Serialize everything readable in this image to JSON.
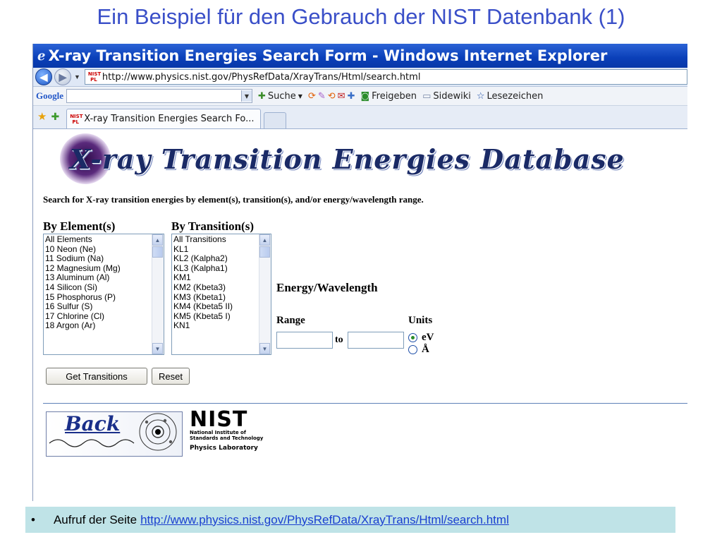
{
  "slide": {
    "title": "Ein Beispiel für den Gebrauch der NIST Datenbank (1)",
    "caption_prefix": "Aufruf der Seite",
    "caption_link": "http://www.physics.nist.gov/PhysRefData/XrayTrans/Html/search.html",
    "bullet": "•"
  },
  "browser": {
    "title": "X-ray Transition Energies Search Form - Windows Internet Explorer",
    "address": "http://www.physics.nist.gov/PhysRefData/XrayTrans/Html/search.html",
    "google_label": "Google",
    "toolbar": {
      "search": "Suche",
      "share": "Freigeben",
      "sidewiki": "Sidewiki",
      "bookmarks": "Lesezeichen"
    },
    "tab_title": "X-ray Transition Energies Search Fo..."
  },
  "page": {
    "db_title": "X-ray Transition Energies Database",
    "description": "Search for X-ray transition energies by element(s), transition(s), and/or energy/wavelength range.",
    "by_element_heading": "By Element(s)",
    "by_transition_heading": "By Transition(s)",
    "elements": [
      "All Elements",
      "10 Neon (Ne)",
      "11 Sodium (Na)",
      "12 Magnesium (Mg)",
      "13 Aluminum (Al)",
      "14 Silicon (Si)",
      "15 Phosphorus (P)",
      "16 Sulfur (S)",
      "17 Chlorine (Cl)",
      "18 Argon (Ar)"
    ],
    "transitions": [
      "All Transitions",
      "KL1",
      "KL2 (Kalpha2)",
      "KL3 (Kalpha1)",
      "KM1",
      "KM2 (Kbeta3)",
      "KM3 (Kbeta1)",
      "KM4 (Kbeta5 II)",
      "KM5 (Kbeta5 I)",
      "KN1"
    ],
    "energy_heading": "Energy/Wavelength",
    "range_label": "Range",
    "units_label": "Units",
    "to_label": "to",
    "range_from": "",
    "range_to": "",
    "unit_ev": "eV",
    "unit_angstrom": "Å",
    "selected_unit": "eV",
    "get_transitions_button": "Get Transitions",
    "reset_button": "Reset",
    "back_label": "Back",
    "nist_logo": "NIST",
    "nist_line1": "National Institute of",
    "nist_line2": "Standards and Technology",
    "physics_lab": "Physics Laboratory"
  },
  "colors": {
    "slide_title": "#3a4fc8",
    "titlebar": "#0a3fb8",
    "caption_bg": "#bfe3e7",
    "link": "#1a3fd0"
  }
}
